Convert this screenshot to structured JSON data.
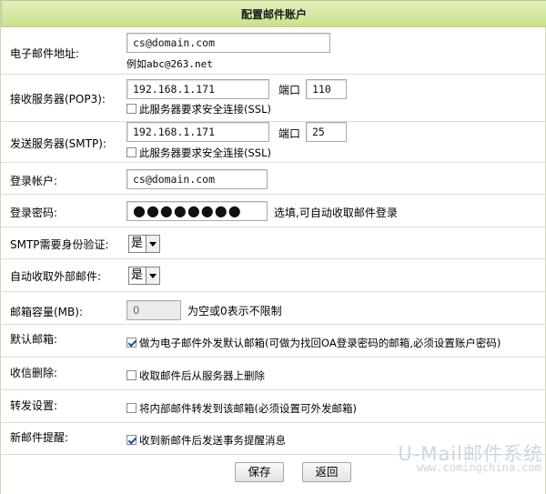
{
  "title": "配置邮件账户",
  "email": {
    "label": "电子邮件地址:",
    "value": "cs@domain.com",
    "hint": "例如abc@263.net"
  },
  "pop3": {
    "label": "接收服务器(POP3):",
    "host": "192.168.1.171",
    "port_label": "端口",
    "port": "110",
    "ssl_label": "此服务器要求安全连接(SSL)"
  },
  "smtp": {
    "label": "发送服务器(SMTP):",
    "host": "192.168.1.171",
    "port_label": "端口",
    "port": "25",
    "ssl_label": "此服务器要求安全连接(SSL)"
  },
  "account": {
    "label": "登录帐户:",
    "value": "cs@domain.com"
  },
  "password": {
    "label": "登录密码:",
    "masked": "●●●●●●●●",
    "hint": "选填,可自动收取邮件登录"
  },
  "smtp_auth": {
    "label": "SMTP需要身份验证:",
    "selected": "是"
  },
  "auto_fetch": {
    "label": "自动收取外部邮件:",
    "selected": "是"
  },
  "quota": {
    "label": "邮箱容量(MB):",
    "value": "0",
    "hint": "为空或0表示不限制"
  },
  "default_mailbox": {
    "label": "默认邮箱:",
    "checked": true,
    "text": "做为电子邮件外发默认邮箱(可做为找回OA登录密码的邮箱,必须设置账户密码)"
  },
  "delete_after": {
    "label": "收信删除:",
    "checked": false,
    "text": "收取邮件后从服务器上删除"
  },
  "forward": {
    "label": "转发设置:",
    "checked": false,
    "text": "将内部邮件转发到该邮箱(必须设置可外发邮箱)"
  },
  "new_mail": {
    "label": "新邮件提醒:",
    "checked": true,
    "text": "收到新邮件后发送事务提醒消息"
  },
  "buttons": {
    "save": "保存",
    "back": "返回"
  },
  "watermark": {
    "brand": "U-Mail邮件系统",
    "site": "www.comingchina.com"
  }
}
